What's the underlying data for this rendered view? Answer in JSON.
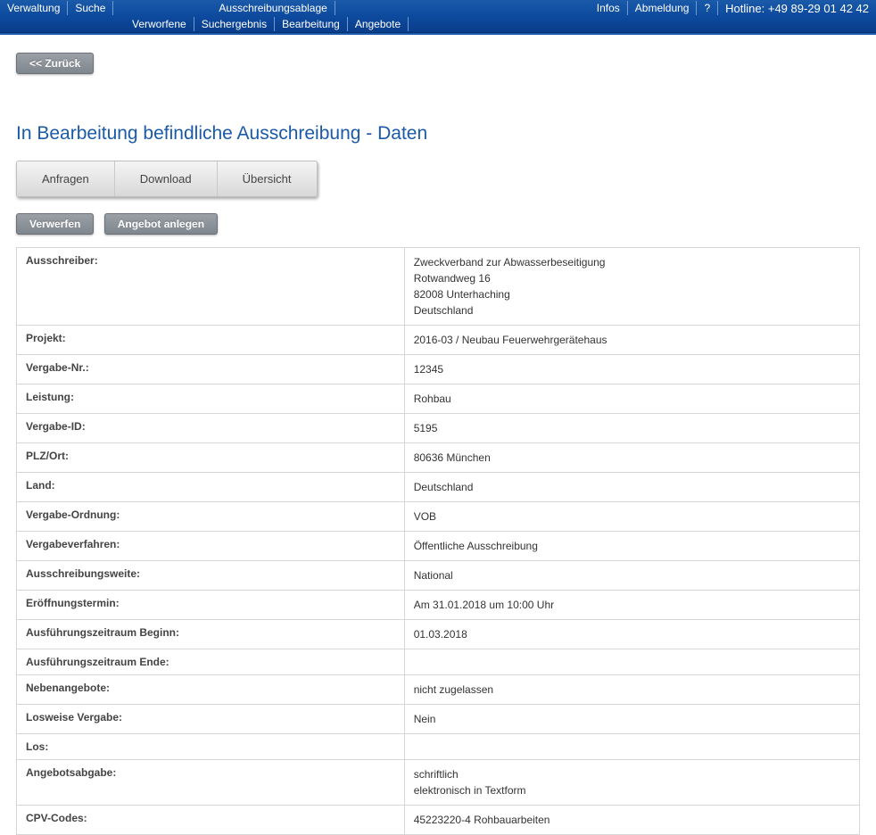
{
  "topmenu": {
    "row1": {
      "verwaltung": "Verwaltung",
      "suche": "Suche",
      "ablage": "Ausschreibungsablage",
      "infos": "Infos",
      "abmeldung": "Abmeldung",
      "help": "?",
      "hotline": "Hotline: +49 89-29 01 42 42"
    },
    "row2": {
      "verworfene": "Verworfene",
      "suchergebnis": "Suchergebnis",
      "bearbeitung": "Bearbeitung",
      "angebote": "Angebote"
    }
  },
  "buttons": {
    "back": "<< Zurück",
    "verwerfen": "Verwerfen",
    "angebot_anlegen": "Angebot anlegen"
  },
  "page": {
    "title": "In Bearbeitung befindliche Ausschreibung - Daten"
  },
  "tabs": {
    "anfragen": "Anfragen",
    "download": "Download",
    "uebersicht": "Übersicht"
  },
  "fields": {
    "ausschreiber_label": "Ausschreiber:",
    "ausschreiber_value": "Zweckverband zur Abwasserbeseitigung\nRotwandweg 16\n82008 Unterhaching\nDeutschland",
    "projekt_label": "Projekt:",
    "projekt_value": "2016-03 / Neubau Feuerwehrgerätehaus",
    "vergabenr_label": "Vergabe-Nr.:",
    "vergabenr_value": "12345",
    "leistung_label": "Leistung:",
    "leistung_value": "Rohbau",
    "vergabeid_label": "Vergabe-ID:",
    "vergabeid_value": "5195",
    "plzort_label": "PLZ/Ort:",
    "plzort_value": "80636 München",
    "land_label": "Land:",
    "land_value": "Deutschland",
    "vergabeordnung_label": "Vergabe-Ordnung:",
    "vergabeordnung_value": "VOB",
    "vergabeverfahren_label": "Vergabeverfahren:",
    "vergabeverfahren_value": "Öffentliche Ausschreibung",
    "ausschreibungsweite_label": "Ausschreibungsweite:",
    "ausschreibungsweite_value": "National",
    "eroeffnung_label": "Eröffnungstermin:",
    "eroeffnung_value": "Am 31.01.2018 um 10:00 Uhr",
    "beginn_label": "Ausführungszeitraum Beginn:",
    "beginn_value": "01.03.2018",
    "ende_label": "Ausführungszeitraum Ende:",
    "ende_value": "",
    "nebenangebote_label": "Nebenangebote:",
    "nebenangebote_value": "nicht zugelassen",
    "losweise_label": "Losweise Vergabe:",
    "losweise_value": "Nein",
    "los_label": "Los:",
    "los_value": "",
    "angebotsabgabe_label": "Angebotsabgabe:",
    "angebotsabgabe_value": "schriftlich\nelektronisch in Textform",
    "cpv_label": "CPV-Codes:",
    "cpv_value": "45223220-4 Rohbauarbeiten"
  }
}
